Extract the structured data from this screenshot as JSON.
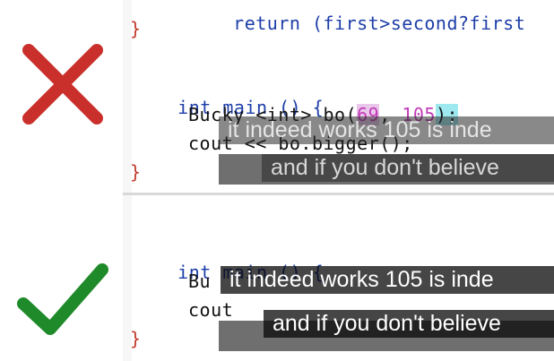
{
  "colors": {
    "cross": "#c9302c",
    "check": "#1f8a2a"
  },
  "icons": {
    "wrong": "x-icon",
    "right": "check-icon"
  },
  "top_panel": {
    "line_return": "return (first>second?first",
    "line_brace_close": "}",
    "line_main": "int main () {",
    "line_bucky_prefix": "Bucky <int> bo(",
    "line_bucky_num1": "69",
    "line_bucky_sep": ", ",
    "line_bucky_num2": "105",
    "line_bucky_end": ");",
    "line_cout": "cout << bo.bigger();",
    "line_final_brace": "}"
  },
  "bottom_panel": {
    "line_main": "int main () {",
    "line_bucky": "Bu",
    "line_cout": "cout",
    "line_final_brace": "}"
  },
  "captions": {
    "top_line1": "it indeed works 105 is inde",
    "top_line2": "and if you don't believe",
    "bottom_line1": "it indeed works 105 is inde",
    "bottom_line2": "and if you don't believe"
  }
}
